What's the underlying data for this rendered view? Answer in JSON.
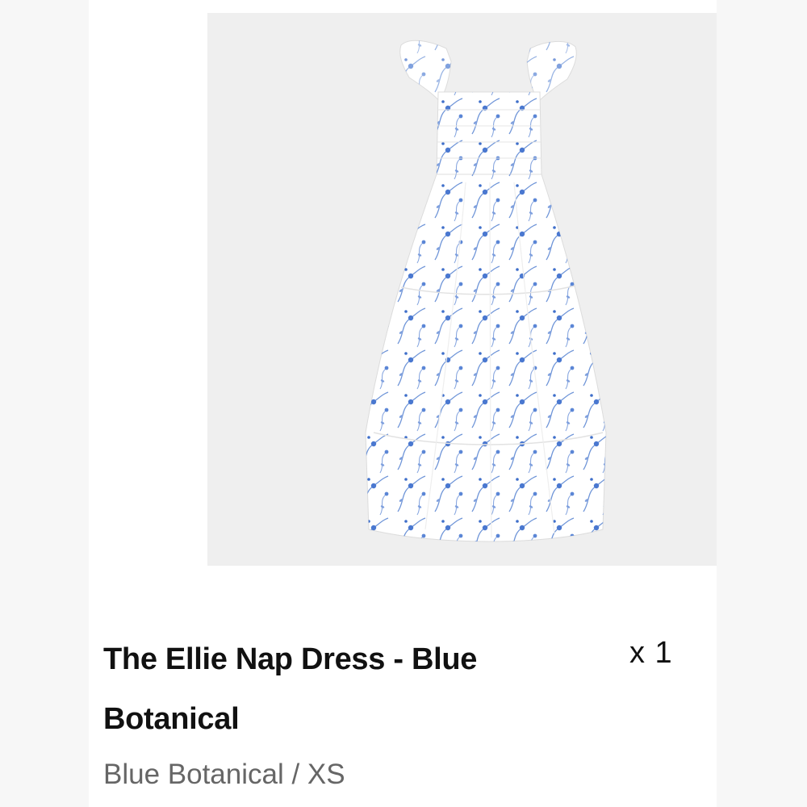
{
  "cart_item": {
    "product_name": "The Ellie Nap Dress - Blue Botanical",
    "quantity_label": "x 1",
    "variant": "Blue Botanical / XS",
    "image_icon": "floral-midi-dress-image"
  },
  "colors": {
    "background": "#f7f7f7",
    "card": "#ffffff",
    "image_bg": "#efefef",
    "title": "#111111",
    "variant_text": "#666666",
    "floral_blue": "#4a78d0"
  }
}
